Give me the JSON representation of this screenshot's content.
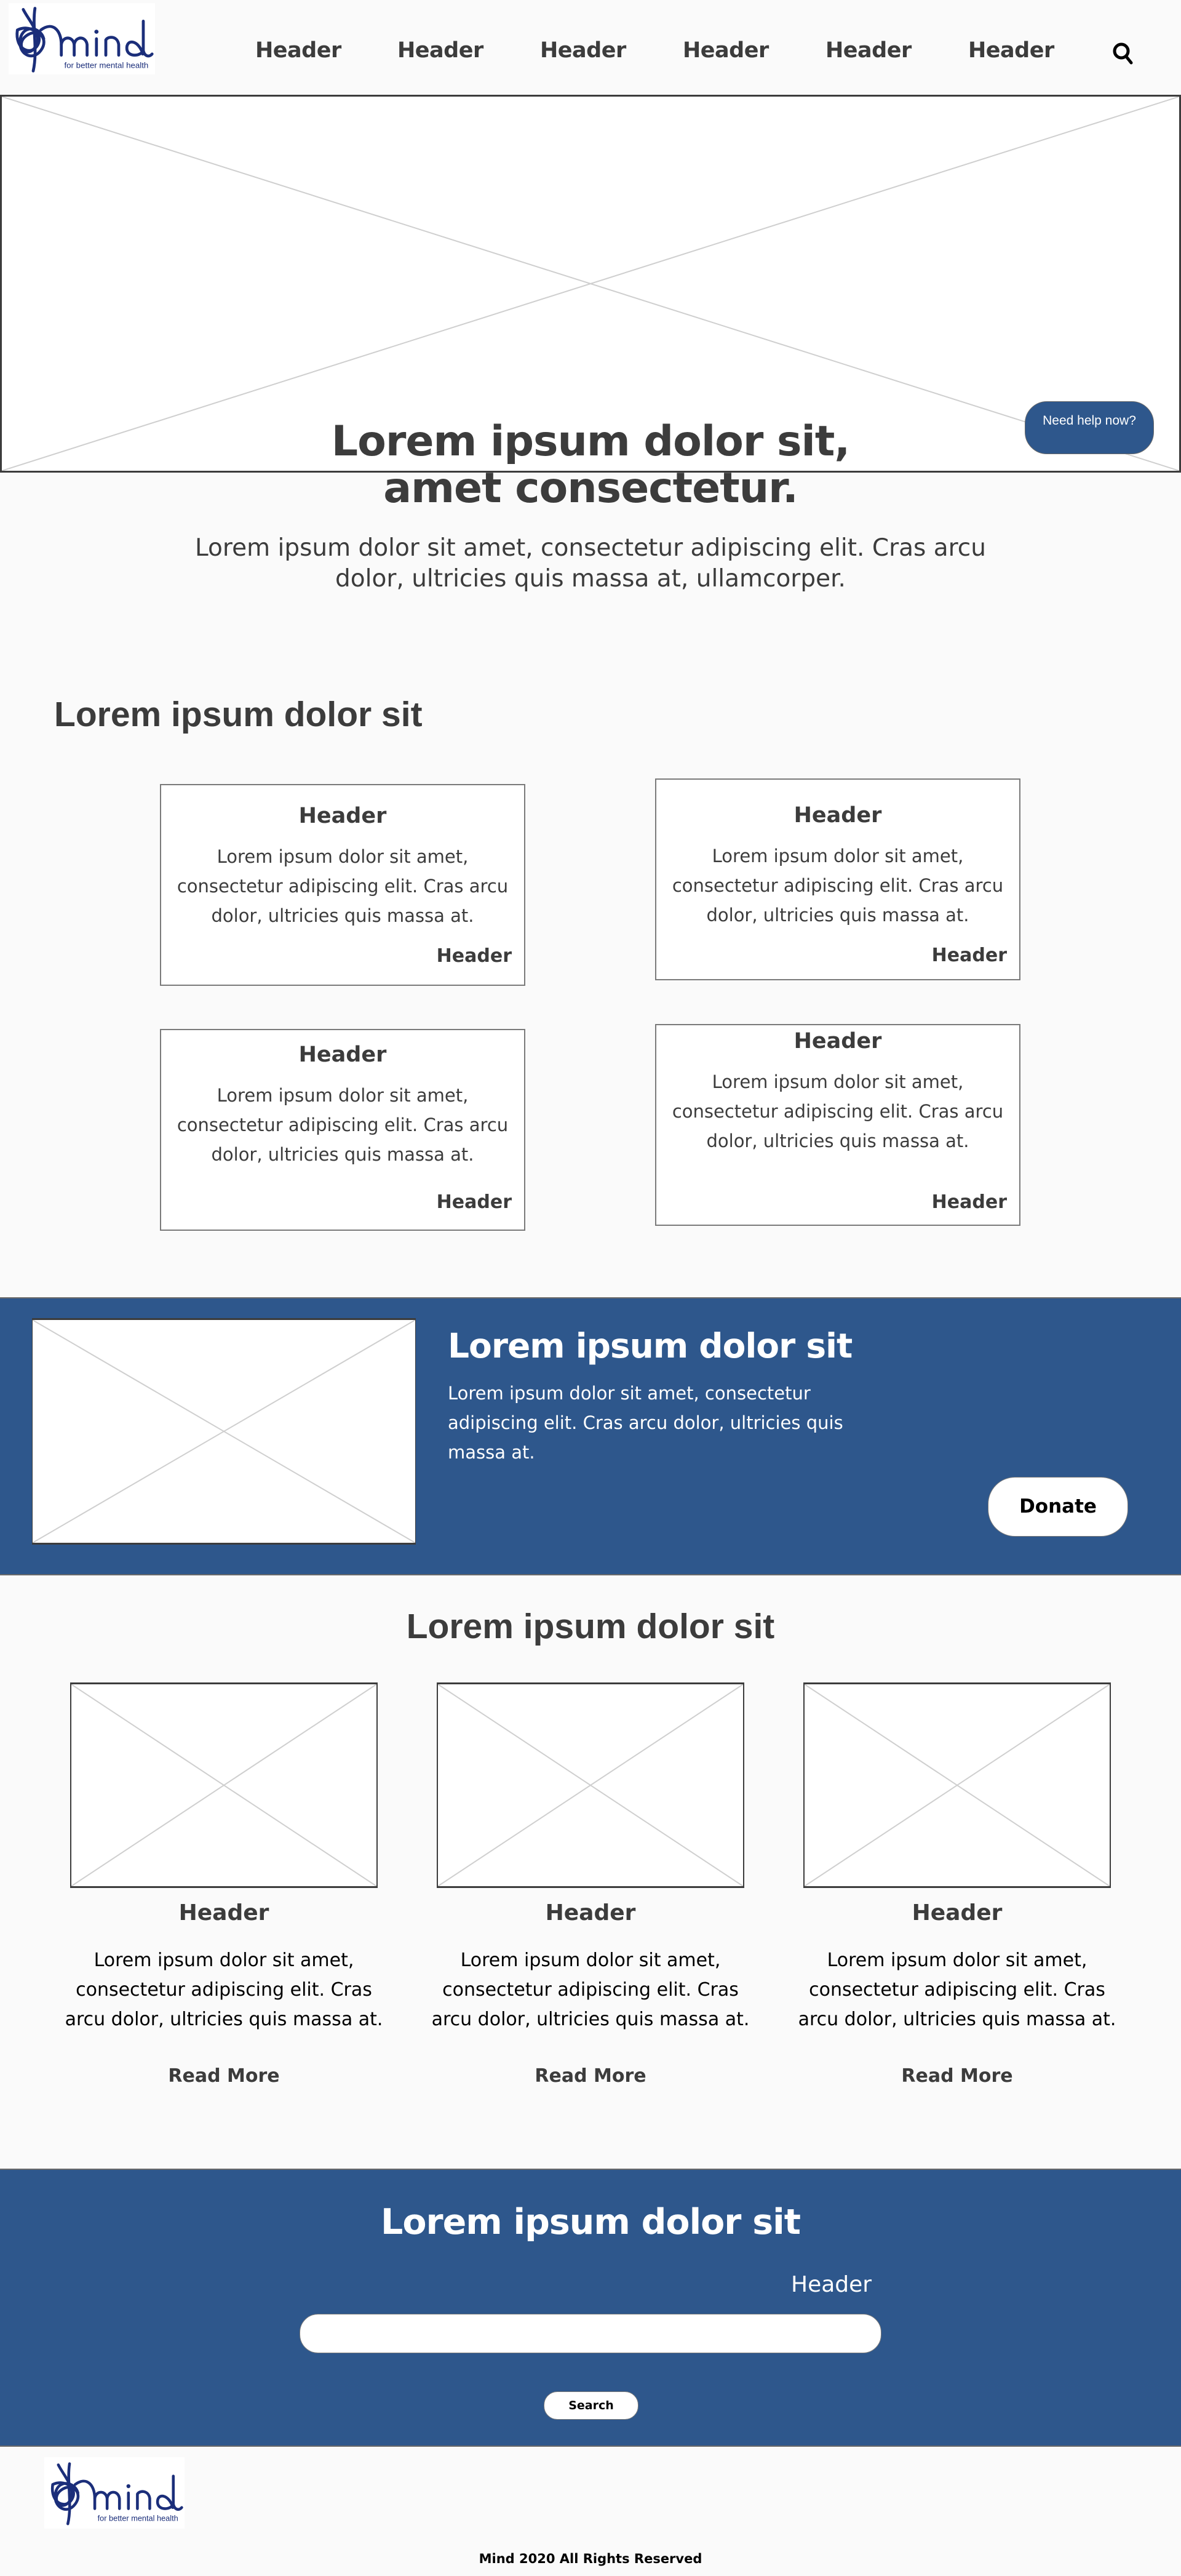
{
  "brand": {
    "name": "mind",
    "tagline": "for better mental health",
    "color": "#1b2e7a"
  },
  "colors": {
    "accent_blue": "#2e578c",
    "text_dark": "#3c3c3c",
    "background": "#fafafa"
  },
  "nav": {
    "items": [
      "Header",
      "Header",
      "Header",
      "Header",
      "Header",
      "Header"
    ],
    "search_icon": "search-icon"
  },
  "hero": {
    "title_line1": "Lorem ipsum dolor sit,",
    "title_line2": "amet consectetur.",
    "subtitle": "Lorem ipsum dolor sit amet, consectetur adipiscing elit. Cras arcu dolor, ultricies quis massa at, ullamcorper.",
    "help_button": "Need help now?"
  },
  "section_cards": {
    "title": "Lorem ipsum dolor sit",
    "cards": [
      {
        "title": "Header",
        "body": "Lorem ipsum dolor sit amet, consectetur adipiscing elit. Cras arcu dolor, ultricies quis massa at.",
        "link": "Header"
      },
      {
        "title": "Header",
        "body": "Lorem ipsum dolor sit amet, consectetur adipiscing elit. Cras arcu dolor, ultricies quis massa at.",
        "link": "Header"
      },
      {
        "title": "Header",
        "body": "Lorem ipsum dolor sit amet, consectetur adipiscing elit. Cras arcu dolor, ultricies quis massa at.",
        "link": "Header"
      },
      {
        "title": "Header",
        "body": "Lorem ipsum dolor sit amet, consectetur adipiscing elit. Cras arcu dolor, ultricies quis massa at.",
        "link": "Header"
      }
    ]
  },
  "donate_band": {
    "title": "Lorem ipsum dolor sit",
    "body": "Lorem ipsum dolor sit amet, consectetur adipiscing elit. Cras arcu dolor, ultricies quis massa at.",
    "button": "Donate"
  },
  "section_articles": {
    "title": "Lorem ipsum dolor sit",
    "articles": [
      {
        "title": "Header",
        "body": "Lorem ipsum dolor sit amet, consectetur adipiscing elit. Cras arcu dolor, ultricies quis massa at.",
        "link": "Read More"
      },
      {
        "title": "Header",
        "body": "Lorem ipsum dolor sit amet, consectetur adipiscing elit. Cras arcu dolor, ultricies quis massa at.",
        "link": "Read More"
      },
      {
        "title": "Header",
        "body": "Lorem ipsum dolor sit amet, consectetur adipiscing elit. Cras arcu dolor, ultricies quis massa at.",
        "link": "Read More"
      }
    ]
  },
  "search_band": {
    "title": "Lorem ipsum dolor sit",
    "label": "Header",
    "input_value": "",
    "button": "Search"
  },
  "footer": {
    "copyright": "Mind 2020 All Rights Reserved"
  }
}
